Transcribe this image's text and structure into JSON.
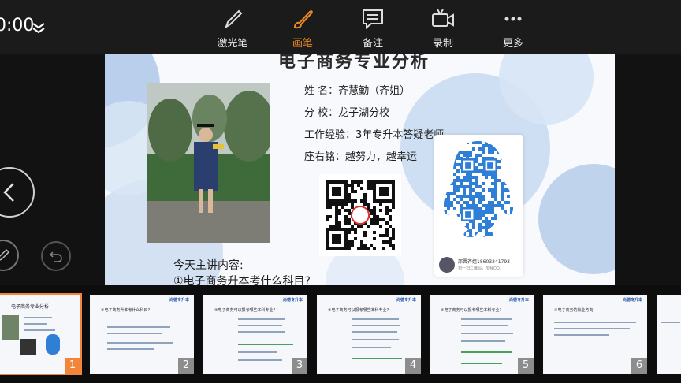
{
  "toolbar": {
    "clock": "0:00",
    "tools": [
      {
        "label": "激光笔",
        "icon": "laser-pen-icon",
        "active": false
      },
      {
        "label": "画笔",
        "icon": "brush-icon",
        "active": true
      },
      {
        "label": "备注",
        "icon": "notes-icon",
        "active": false
      },
      {
        "label": "录制",
        "icon": "record-icon",
        "active": false
      },
      {
        "label": "更多",
        "icon": "more-icon",
        "active": false
      }
    ],
    "accent": "#f08a24"
  },
  "slide": {
    "title": "电子商务专业分析",
    "info": [
      {
        "label": "姓    名：",
        "value": "齐慧勤（齐姐）"
      },
      {
        "label": "分    校：",
        "value": "龙子湖分校"
      },
      {
        "label": "工作经验：",
        "value": "3年专升本答疑老师"
      },
      {
        "label": "座右铭：",
        "value": "越努力，越幸运"
      }
    ],
    "qq_card": {
      "name": "邵晋齐姐18603241793",
      "sub": "扫一扫二维码，加我QQ。"
    },
    "lesson_heading": "今天主讲内容:",
    "lesson_item": "①电子商务升本考什么科目?"
  },
  "thumbnails": [
    {
      "num": "1",
      "title": "电子商务专业分析",
      "selected": true
    },
    {
      "num": "2",
      "title": "①电子商务升本考什么科目?",
      "selected": false
    },
    {
      "num": "3",
      "title": "②电子商务可以报考哪些本科专业?",
      "selected": false
    },
    {
      "num": "4",
      "title": "②电子商务可以报考哪些本科专业?",
      "selected": false
    },
    {
      "num": "5",
      "title": "②电子商务可以报考哪些本科专业?",
      "selected": false
    },
    {
      "num": "6",
      "title": "③电子商务的就业方向",
      "selected": false
    }
  ],
  "thumb_logo": "尚德专升本"
}
